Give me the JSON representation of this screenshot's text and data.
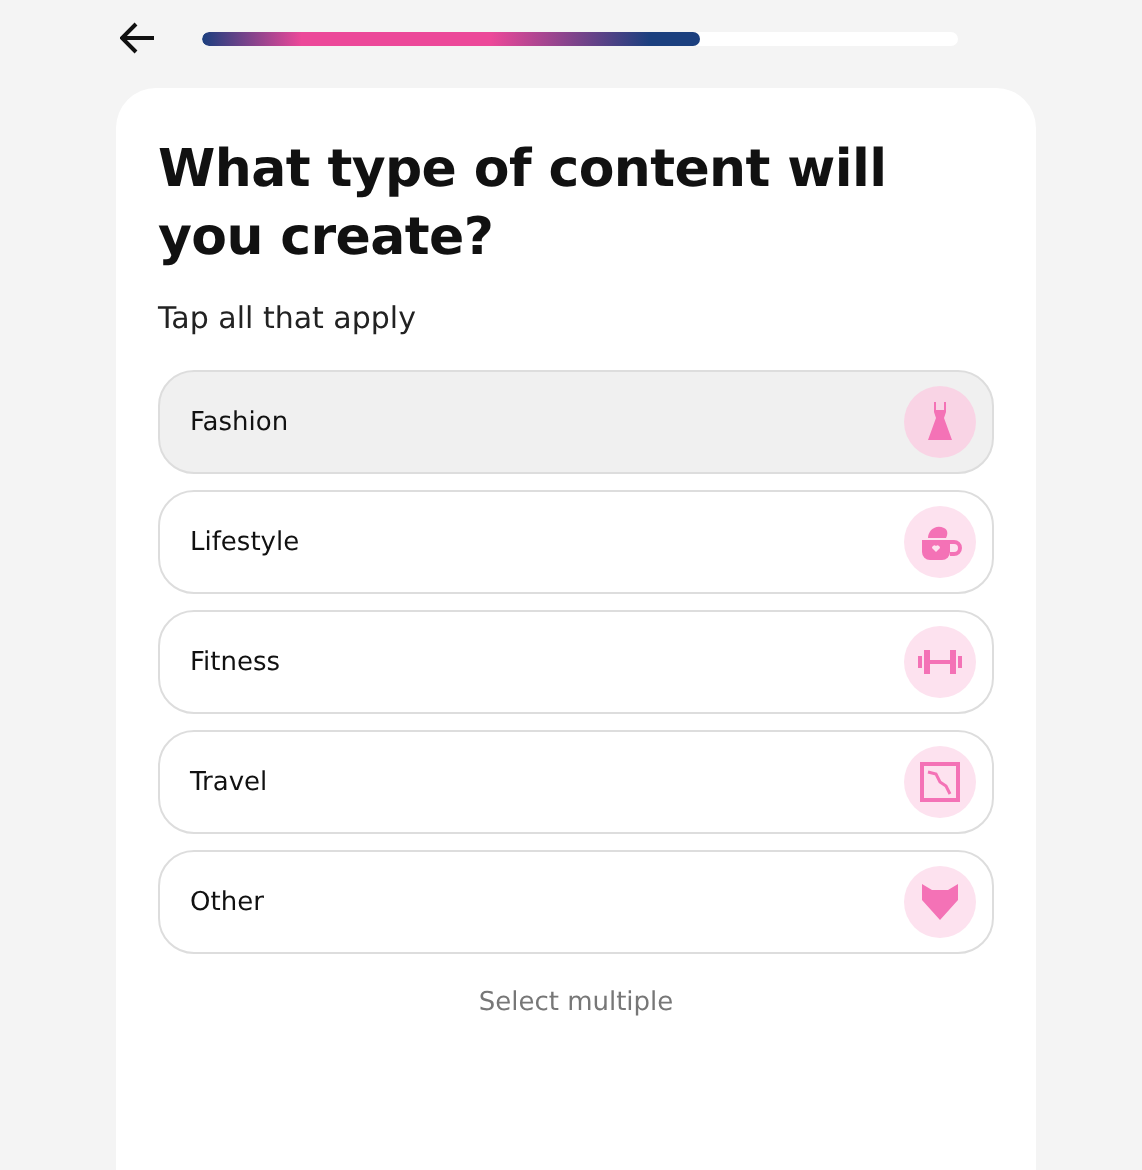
{
  "progress": {
    "level": 0.66
  },
  "title": "What type of content will you create?",
  "subtitle": "Tap all that apply",
  "options": [
    {
      "label": "Fashion",
      "kind": "dress",
      "selected": true
    },
    {
      "label": "Lifestyle",
      "kind": "cup",
      "selected": false
    },
    {
      "label": "Fitness",
      "kind": "dumbbell",
      "selected": false
    },
    {
      "label": "Travel",
      "kind": "map",
      "selected": false
    },
    {
      "label": "Other",
      "kind": "heart",
      "selected": false
    }
  ],
  "hint": "Select multiple"
}
